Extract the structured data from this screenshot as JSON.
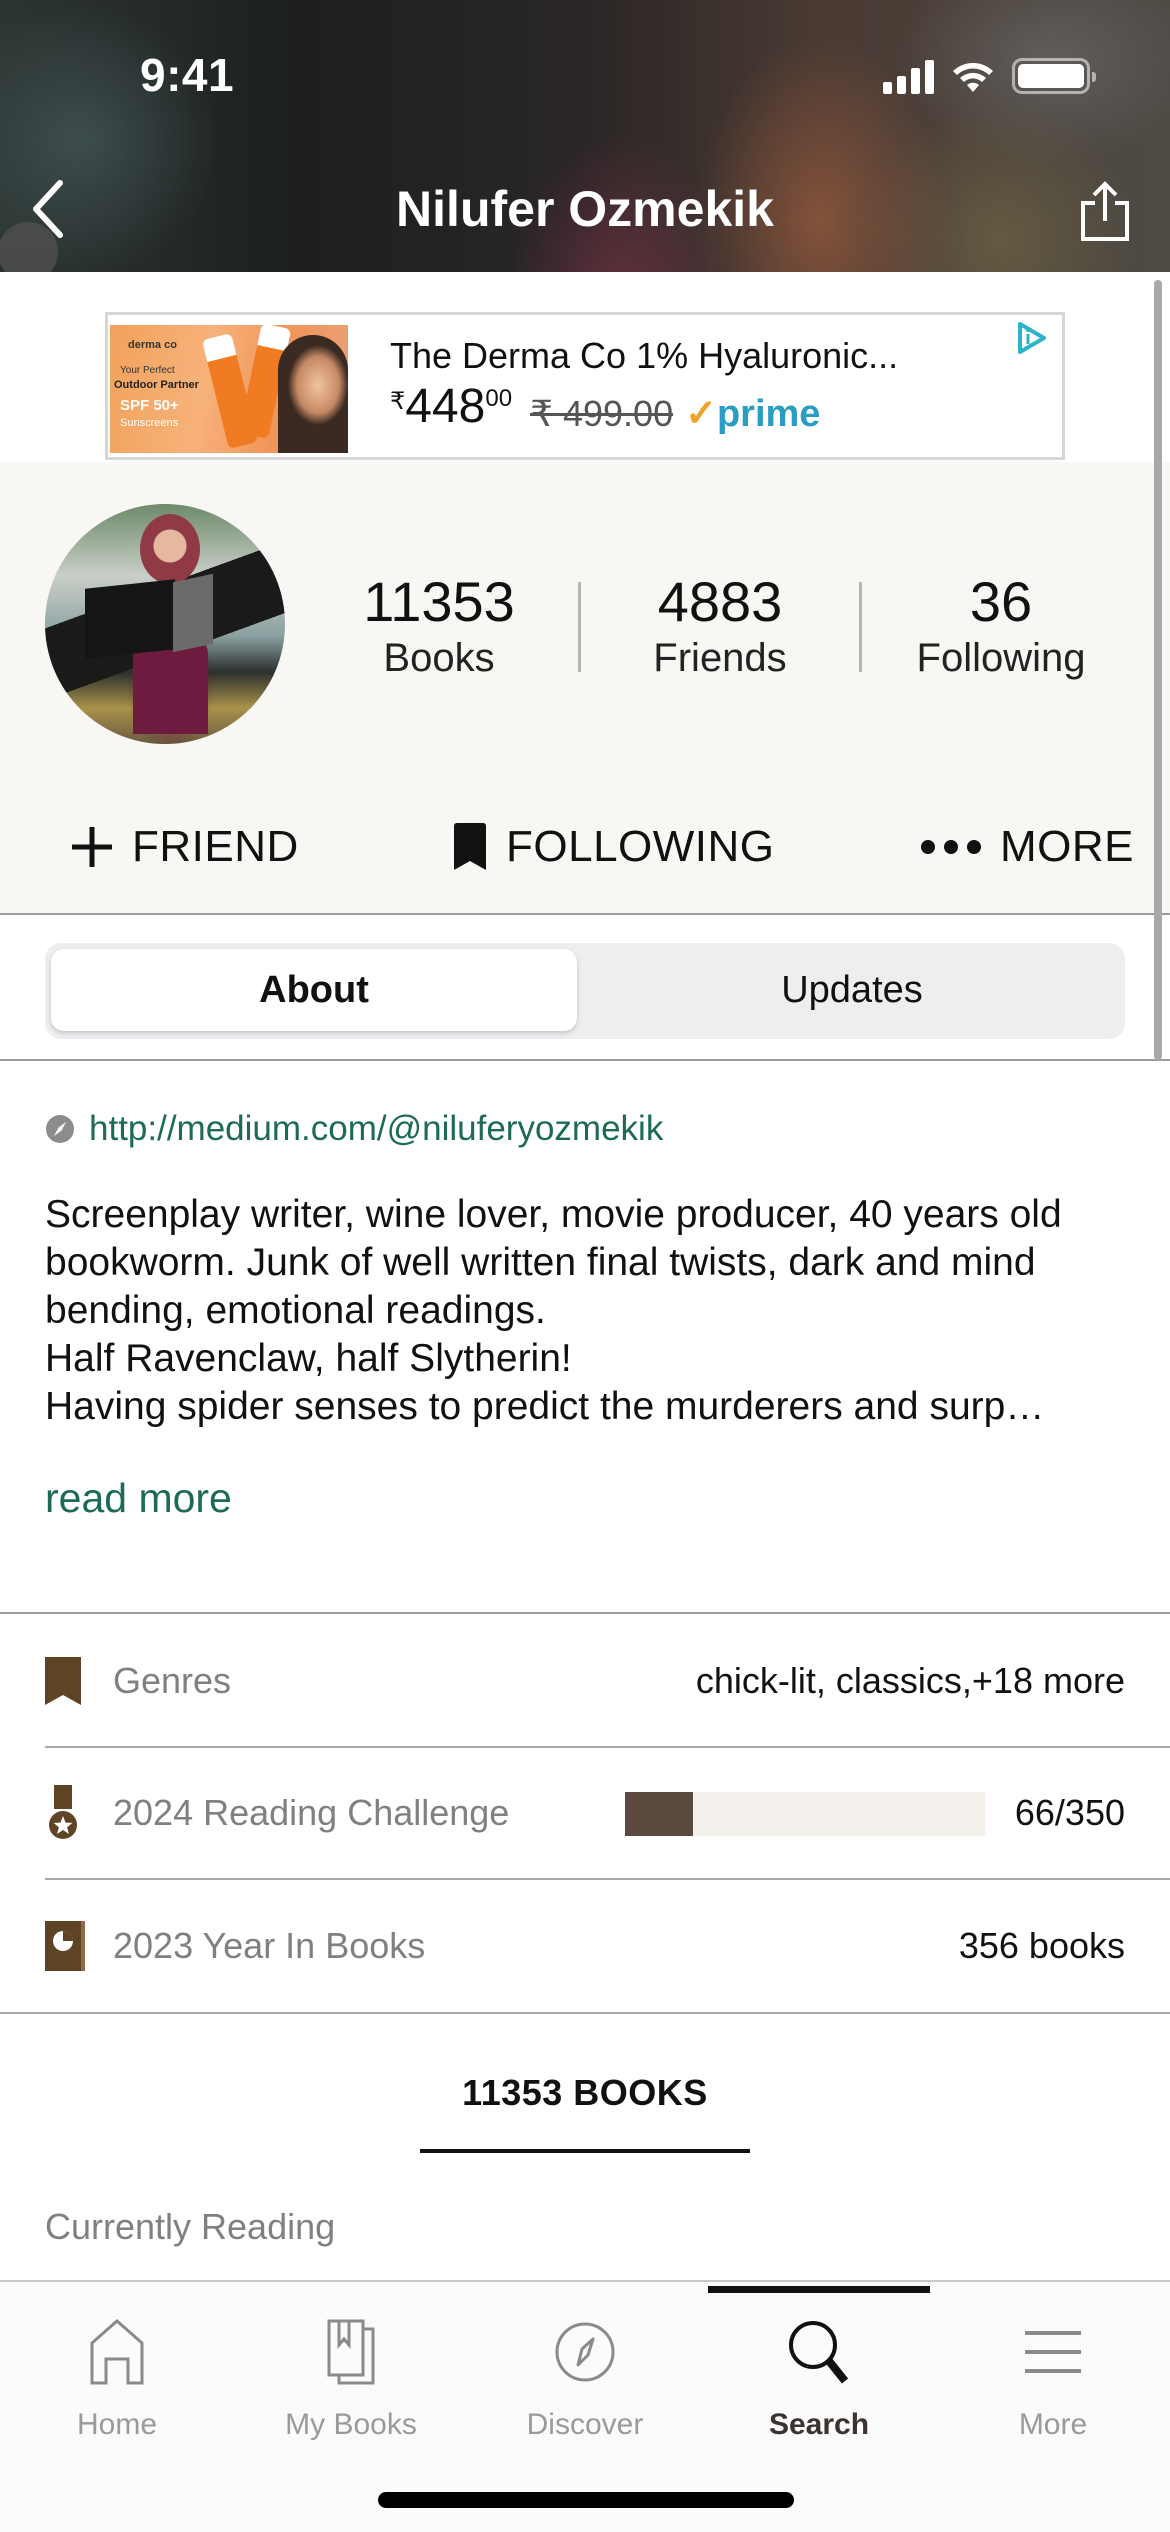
{
  "status_bar": {
    "time": "9:41"
  },
  "nav": {
    "title": "Nilufer Ozmekik",
    "back_icon": "chevron-left-icon",
    "share_icon": "share-icon"
  },
  "ad": {
    "image_texts": {
      "brand": "derma co",
      "line1": "Your Perfect",
      "line2": "Outdoor Partner",
      "line3": "SPF 50+",
      "line4": "Sunscreens"
    },
    "title": "The Derma Co 1% Hyaluronic...",
    "currency": "₹",
    "price_whole": "448",
    "price_fraction": "00",
    "old_price": "₹ 499.00",
    "prime_check": "✓",
    "prime_label": "prime",
    "adchoices_icon": "adchoices-icon"
  },
  "profile": {
    "stats": [
      {
        "value": "11353",
        "label": "Books"
      },
      {
        "value": "4883",
        "label": "Friends"
      },
      {
        "value": "36",
        "label": "Following"
      }
    ],
    "actions": {
      "friend": {
        "label": "FRIEND",
        "icon": "plus-icon"
      },
      "following": {
        "label": "FOLLOWING",
        "icon": "bookmark-icon"
      },
      "more": {
        "label": "MORE",
        "icon": "ellipsis-icon"
      }
    }
  },
  "segments": {
    "about": "About",
    "updates": "Updates",
    "active": "About"
  },
  "about": {
    "link": "http://medium.com/@niluferyozmekik",
    "bio": "Screenplay writer, wine lover, movie producer, 40 years old bookworm. Junk of well written final twists, dark and mind bending, emotional readings.\nHalf Ravenclaw, half Slytherin!\nHaving spider senses to predict the murderers and surp…",
    "read_more": "read more"
  },
  "info": {
    "genres": {
      "label": "Genres",
      "value": "chick-lit, classics,+18 more"
    },
    "challenge": {
      "label": "2024 Reading Challenge",
      "progress_text": "66/350",
      "read": 66,
      "goal": 350
    },
    "year_in_books": {
      "label": "2023 Year In Books",
      "value": "356 books"
    }
  },
  "books_section": {
    "tab_label": "11353 BOOKS",
    "shelf_heading": "Currently Reading"
  },
  "tabbar": {
    "items": [
      {
        "label": "Home",
        "icon": "home-icon"
      },
      {
        "label": "My Books",
        "icon": "my-books-icon"
      },
      {
        "label": "Discover",
        "icon": "compass-icon"
      },
      {
        "label": "Search",
        "icon": "search-icon"
      },
      {
        "label": "More",
        "icon": "menu-icon"
      }
    ],
    "active": "Search"
  },
  "colors": {
    "link_green": "#1d6b57",
    "icon_brown": "#5f4325",
    "progress_fill": "#5c4a40",
    "profile_bg": "#f8f7f4",
    "prime_blue": "#2a9dc4"
  }
}
